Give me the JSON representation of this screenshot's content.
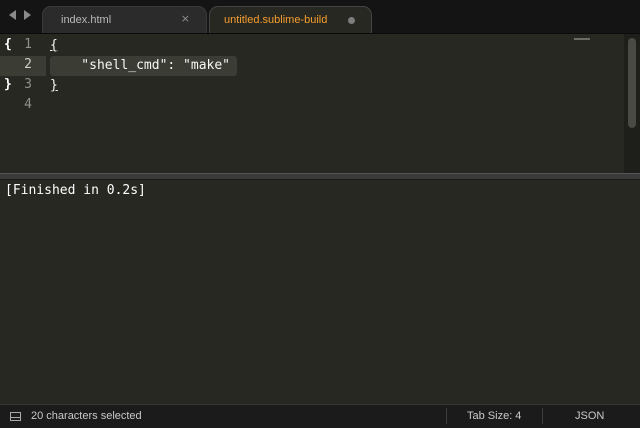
{
  "nav": {
    "back_icon": "chevron-left-icon",
    "forward_icon": "chevron-right-icon"
  },
  "tabs": [
    {
      "label": "index.html",
      "close": "×",
      "active": false
    },
    {
      "label": "untitled.sublime-build",
      "close": "●",
      "active": true
    }
  ],
  "editor": {
    "lines": [
      {
        "number": "1",
        "fold": "{",
        "code": "{"
      },
      {
        "number": "2",
        "fold": "",
        "code": "    \"shell_cmd\": \"make\""
      },
      {
        "number": "3",
        "fold": "}",
        "code": "}"
      },
      {
        "number": "4",
        "fold": "",
        "code": ""
      }
    ],
    "current_line": "2"
  },
  "output": {
    "text": "[Finished in 0.2s]"
  },
  "status": {
    "selection": "20 characters selected",
    "tab_size": "Tab Size: 4",
    "syntax": "JSON"
  },
  "colors": {
    "background": "#272822",
    "active_tab_label": "#f79e2c",
    "tabbar": "#141414"
  }
}
